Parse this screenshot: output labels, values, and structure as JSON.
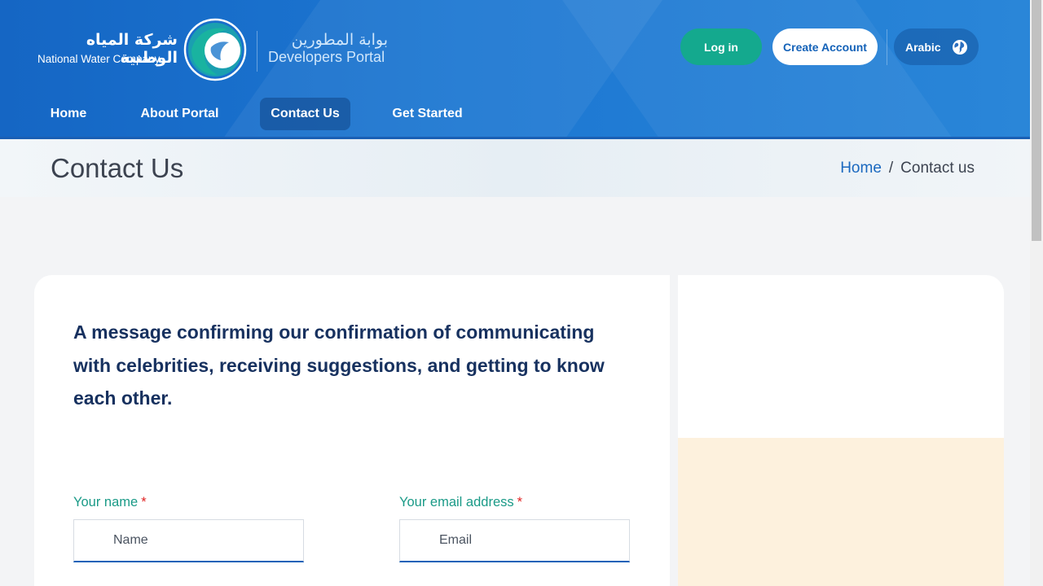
{
  "brand": {
    "company_ar": "شركة المياه الوطنية",
    "company_en": "National Water Company",
    "portal_ar": "بوابة المطورين",
    "portal_en": "Developers Portal"
  },
  "header_actions": {
    "login_label": "Log in",
    "create_account_label": "Create Account",
    "language_label": "Arabic",
    "language_icon": "globe-icon"
  },
  "nav": {
    "items": [
      {
        "label": "Home",
        "active": false
      },
      {
        "label": "About Portal",
        "active": false
      },
      {
        "label": "Contact Us",
        "active": true
      },
      {
        "label": "Get Started",
        "active": false
      }
    ]
  },
  "page": {
    "title": "Contact Us",
    "breadcrumb": {
      "home": "Home",
      "separator": "/",
      "current": "Contact us"
    }
  },
  "contact_form": {
    "message": "A message confirming our confirmation of communicating with celebrities, receiving suggestions, and getting to know each other.",
    "name_label": "Your name",
    "name_placeholder": "Name",
    "email_label": "Your email address",
    "email_placeholder": "Email",
    "required_marker": "*"
  },
  "colors": {
    "header_blue": "#1c77d2",
    "login_green": "#14a98e",
    "label_teal": "#1a9a87",
    "heading_navy": "#17315f",
    "side_panel_cream": "#fdf1dd"
  }
}
